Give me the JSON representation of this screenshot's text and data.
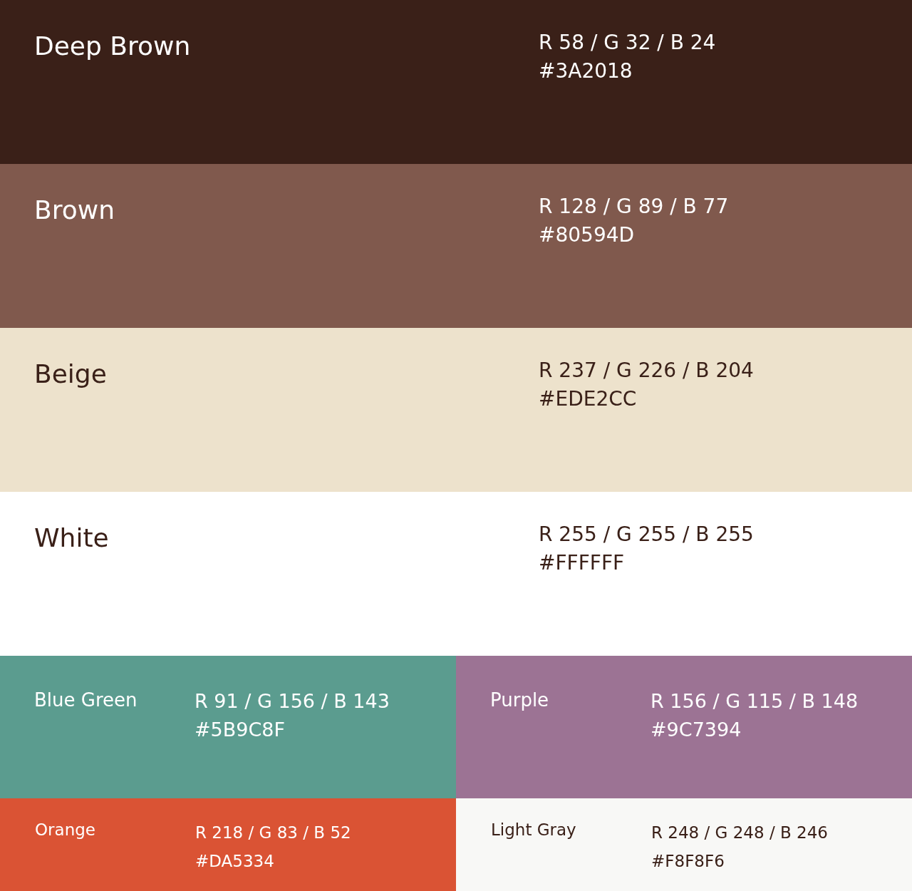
{
  "rows": [
    {
      "kind": "large",
      "swatches": [
        {
          "name": "Deep Brown",
          "rgb": "R 58 / G 32 / B 24",
          "hex": "#3A2018",
          "color": "#3a2018"
        }
      ]
    },
    {
      "kind": "large",
      "swatches": [
        {
          "name": "Brown",
          "rgb": "R 128 / G 89 / B 77",
          "hex": "#80594D",
          "color": "#80594d"
        }
      ]
    },
    {
      "kind": "large",
      "swatches": [
        {
          "name": "Beige",
          "rgb": "R 237 / G 226 / B 204",
          "hex": "#EDE2CC",
          "color": "#ede2cc"
        }
      ]
    },
    {
      "kind": "large",
      "swatches": [
        {
          "name": "White",
          "rgb": "R 255 / G 255 / B 255",
          "hex": "#FFFFFF",
          "color": "#ffffff"
        }
      ]
    },
    {
      "kind": "medium",
      "swatches": [
        {
          "name": "Blue Green",
          "rgb": "R 91 / G 156 / B 143",
          "hex": "#5B9C8F",
          "color": "#5b9c8f"
        },
        {
          "name": "Purple",
          "rgb": "R 156 / G 115 / B 148",
          "hex": "#9C7394",
          "color": "#9c7394"
        }
      ]
    },
    {
      "kind": "small",
      "swatches": [
        {
          "name": "Orange",
          "rgb": "R 218 / G 83 / B 52",
          "hex": "#DA5334",
          "color": "#da5334"
        },
        {
          "name": "Light Gray",
          "rgb": "R 248 / G 248 / B 246",
          "hex": "#F8F8F6",
          "color": "#f8f8f6"
        }
      ]
    }
  ]
}
